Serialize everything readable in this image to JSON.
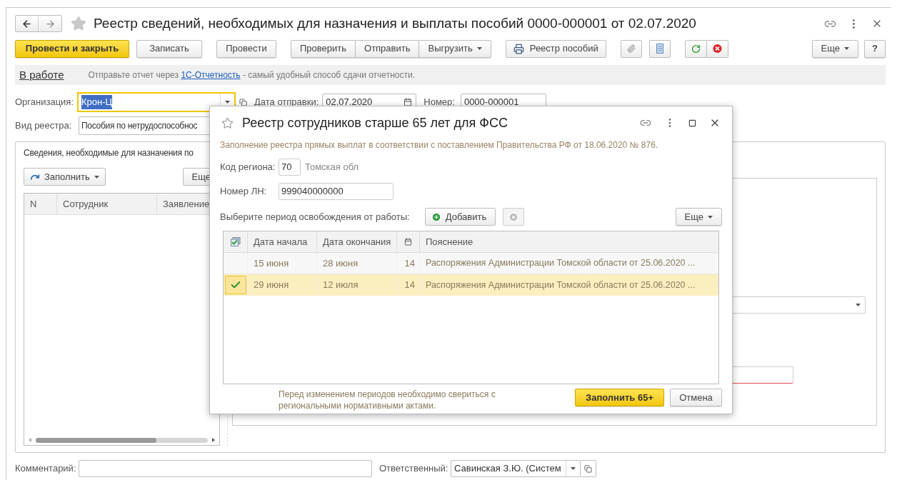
{
  "window": {
    "title": "Реестр сведений, необходимых для назначения и выплаты пособий 0000-000001 от 02.07.2020"
  },
  "toolbar": {
    "buttons": [
      {
        "label": "Провести и закрыть",
        "kind": "primary"
      },
      {
        "label": "Записать",
        "kind": "plain"
      },
      {
        "label": "Провести",
        "kind": "plain"
      }
    ],
    "group": [
      {
        "label": "Проверить",
        "kind": "plain"
      },
      {
        "label": "Отправить",
        "kind": "plain"
      },
      {
        "label": "Выгрузить",
        "kind": "menu"
      }
    ],
    "print": "Реестр пособий",
    "more": "Еще",
    "help": "?"
  },
  "status": {
    "state": "В работе",
    "before": "Отправьте отчет через",
    "link": "1С-Отчетность",
    "after": "- самый удобный способ сдачи отчетности."
  },
  "organization": {
    "label": "Организация:",
    "value": "Крон-Ц",
    "focused": true
  },
  "send_date": {
    "label": "Дата отправки:",
    "value": "02.07.2020"
  },
  "number": {
    "label": "Номер:",
    "value": "0000-000001"
  },
  "registry_type": {
    "label": "Вид реестра:",
    "value": "Пособия по нетрудоспособнос"
  },
  "group_title": "Сведения, необходимые для назначения по",
  "employees": {
    "fill": "Заполнить",
    "more": "Еще",
    "columns": [
      "N",
      "Сотрудник",
      "Заявление"
    ]
  },
  "comment": {
    "label": "Комментарий:"
  },
  "responsible": {
    "label": "Ответственный:",
    "value": "Савинская З.Ю. (Систем"
  },
  "dialog": {
    "title": "Реестр сотрудников старше 65 лет для ФСС",
    "note": "Заполнение реестра прямых выплат в соответствии с поставлением Правительства РФ от 18.06.2020 № 876.",
    "region": {
      "label": "Код региона:",
      "value": "70",
      "name": "Томская обл"
    },
    "ln": {
      "label": "Номер ЛН:",
      "value": "999040000000"
    },
    "period_label": "Выберите период освобождения от работы:",
    "add": "Добавить",
    "more": "Еще",
    "columns": {
      "start": "Дата начала",
      "end": "Дата окончания",
      "note": "Пояснение"
    },
    "rows": [
      {
        "checked": false,
        "selected": false,
        "start": "15 июня",
        "end": "28 июня",
        "days": "14",
        "note": "Распоряжения Администрации Томской области от 25.06.2020 ..."
      },
      {
        "checked": true,
        "selected": true,
        "start": "29 июня",
        "end": "12 июля",
        "days": "14",
        "note": "Распоряжения Администрации Томской области от 25.06.2020 ..."
      }
    ],
    "hint": "Перед изменением периодов необходимо свериться с региональными нормативными актами.",
    "ok": "Заполнить 65+",
    "cancel": "Отмена"
  }
}
